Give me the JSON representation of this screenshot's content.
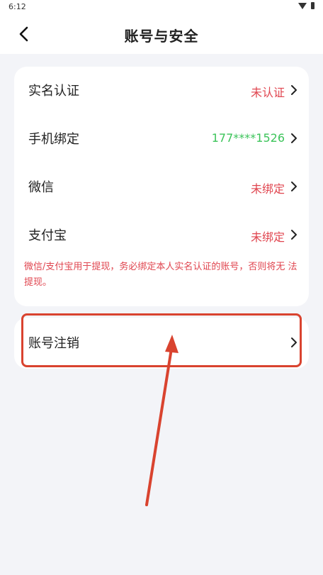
{
  "status_bar": {
    "time": "6:12"
  },
  "header": {
    "title": "账号与安全"
  },
  "security_items": [
    {
      "label": "实名认证",
      "value": "未认证",
      "value_color": "#e0454f"
    },
    {
      "label": "手机绑定",
      "value": "177****1526",
      "value_color": "#3cc45a"
    },
    {
      "label": "微信",
      "value": "未绑定",
      "value_color": "#e0454f"
    },
    {
      "label": "支付宝",
      "value": "未绑定",
      "value_color": "#e0454f"
    }
  ],
  "notice": "微信/支付宝用于提现，务必绑定本人实名认证的账号，否则将无 法提现。",
  "cancel_account": {
    "label": "账号注销"
  },
  "colors": {
    "accent_red": "#e0454f",
    "accent_green": "#3cc45a",
    "annotation_red": "#d9432f",
    "background": "#f3f4f8"
  }
}
